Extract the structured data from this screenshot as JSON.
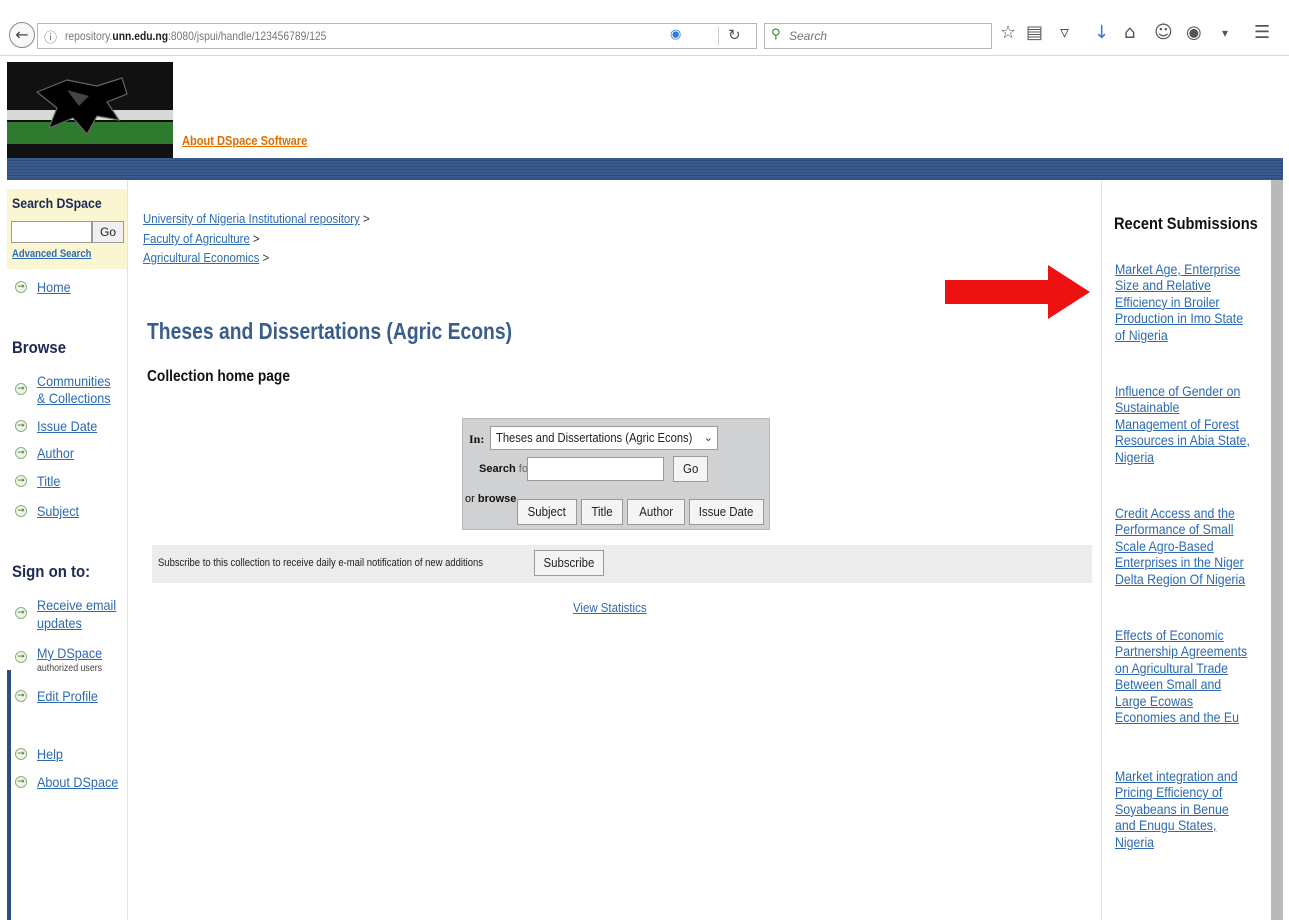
{
  "browser": {
    "url_prefix": "repository.",
    "url_domain": "unn.edu.ng",
    "url_rest": ":8080/jspui/handle/123456789/125",
    "search_placeholder": "Search"
  },
  "header": {
    "about_link": "About DSpace Software"
  },
  "left_sidebar": {
    "search_title": "Search DSpace",
    "go_label": "Go",
    "advanced_search": "Advanced Search",
    "home": "Home",
    "browse_title": "Browse",
    "browse_items": [
      "Communities",
      "& Collections",
      "Issue Date",
      "Author",
      "Title",
      "Subject"
    ],
    "sign_on_title": "Sign on to:",
    "receive_email": [
      "Receive email",
      "updates"
    ],
    "my_dspace": "My DSpace",
    "authorized_users": "authorized users",
    "edit_profile": "Edit Profile",
    "help": "Help",
    "about_dspace": "About DSpace"
  },
  "breadcrumbs": [
    "University of Nigeria Institutional repository",
    "Faculty of Agriculture",
    "Agricultural Economics"
  ],
  "breadcrumb_sep": ">",
  "main": {
    "title": "Theses and Dissertations (Agric Econs)",
    "subtitle": "Collection home page"
  },
  "search_panel": {
    "in_label": "In:",
    "scope_value": "Theses and Dissertations (Agric Econs)",
    "search_label": "Search",
    "for_label": "for",
    "go_label": "Go",
    "or_label": "or",
    "browse_label": "browse",
    "browse_buttons": [
      "Subject",
      "Title",
      "Author",
      "Issue Date"
    ]
  },
  "subscribe": {
    "text": "Subscribe to this collection to receive daily e-mail notification of new additions",
    "button": "Subscribe"
  },
  "view_statistics": "View Statistics",
  "recent_submissions": {
    "title": "Recent Submissions",
    "items": [
      [
        "Market Age, Enterprise",
        "Size and Relative",
        "Efficiency in Broiler",
        "Production in Imo State",
        "of Nigeria"
      ],
      [
        "Influence of Gender on",
        "Sustainable",
        "Management of Forest",
        "Resources in Abia State,",
        "Nigeria"
      ],
      [
        "Credit Access and the",
        "Performance of Small",
        "Scale Agro-Based",
        "Enterprises in the Niger",
        "Delta Region Of Nigeria"
      ],
      [
        "Effects of Economic",
        "Partnership Agreements",
        "on Agricultural Trade",
        "Between Small and",
        "Large Ecowas",
        "Economies and the Eu"
      ],
      [
        "Market integration and",
        "Pricing Efficiency of",
        "Soyabeans in Benue",
        "and Enugu States,",
        "Nigeria"
      ]
    ]
  },
  "colors": {
    "link": "#2d6ab3",
    "nav_stripe": "#3a5a8c",
    "title": "#3a5e8c",
    "arrow": "#ee1111",
    "about_link": "#e06d00"
  },
  "icons": {
    "back": "back-arrow-icon",
    "bullet": "arrow-circle-icon",
    "toolbar": [
      "star-icon",
      "reading-list-icon",
      "pocket-icon",
      "download-icon",
      "home-icon",
      "chat-icon",
      "extension-icon",
      "menu-icon"
    ]
  }
}
